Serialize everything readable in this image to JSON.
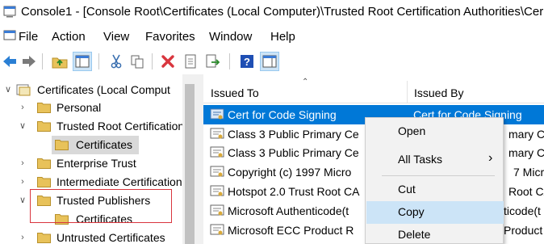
{
  "window": {
    "title": "Console1 - [Console Root\\Certificates (Local Computer)\\Trusted Root Certification Authorities\\Cer"
  },
  "menu": [
    "File",
    "Action",
    "View",
    "Favorites",
    "Window",
    "Help"
  ],
  "toolbar": {
    "icons": [
      "back-icon",
      "forward-icon",
      "up-folder-icon",
      "show-hide-tree-icon",
      "cut-icon",
      "copy-icon",
      "delete-icon",
      "properties-icon",
      "export-icon",
      "help-icon",
      "show-action-pane-icon"
    ],
    "colors": {
      "delete": "#d9363e",
      "help": "#1f4fb4",
      "arrow": "#2a7fd4"
    }
  },
  "tree": {
    "root": "Certificates (Local Comput",
    "items": [
      {
        "label": "Personal",
        "expanded": false
      },
      {
        "label": "Trusted Root Certification",
        "expanded": true
      },
      {
        "label": "Certificates",
        "child": true,
        "selected": true
      },
      {
        "label": "Enterprise Trust",
        "expanded": false
      },
      {
        "label": "Intermediate Certification",
        "expanded": false
      },
      {
        "label": "Trusted Publishers",
        "expanded": true,
        "highlighted": true
      },
      {
        "label": "Certificates",
        "child": true,
        "highlighted": true
      },
      {
        "label": "Untrusted Certificates",
        "expanded": false
      }
    ]
  },
  "list": {
    "columns": [
      "Issued To",
      "Issued By"
    ],
    "rows": [
      {
        "issued_to": "Cert for Code Signing",
        "issued_by": "Cert for Code Signing",
        "selected": true
      },
      {
        "issued_to": "Class 3 Public Primary Ce",
        "issued_by": "mary Ce"
      },
      {
        "issued_to": "Class 3 Public Primary Ce",
        "issued_by": "mary Ce"
      },
      {
        "issued_to": "Copyright (c) 1997 Micro",
        "issued_by": "7 Micro"
      },
      {
        "issued_to": "Hotspot 2.0 Trust Root CA",
        "issued_by": "Root CA"
      },
      {
        "issued_to": "Microsoft Authenticode(t",
        "issued_by": "ticode(t"
      },
      {
        "issued_to": "Microsoft ECC Product R",
        "issued_by": "Product R"
      }
    ]
  },
  "context_menu": {
    "items": [
      {
        "label": "Open",
        "submenu": false
      },
      {
        "label": "All Tasks",
        "submenu": true
      },
      {
        "label": "Cut",
        "submenu": false
      },
      {
        "label": "Copy",
        "submenu": false,
        "highlighted": true
      },
      {
        "label": "Delete",
        "submenu": false
      }
    ],
    "submenu_arrow": "›"
  },
  "colors": {
    "selection": "#0078d7",
    "menu_highlight": "#cce4f7",
    "annotation_box": "#d9363e",
    "folder": "#e8c25a"
  }
}
